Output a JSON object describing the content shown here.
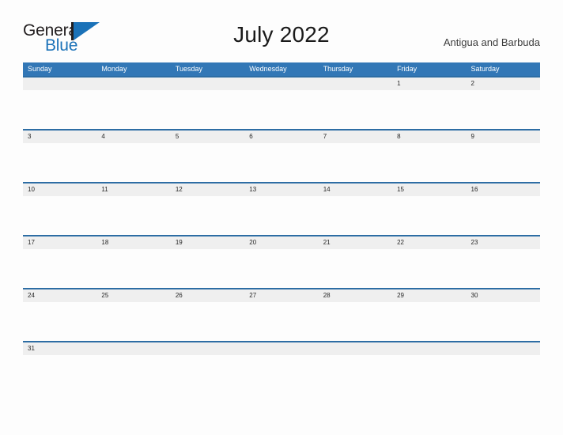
{
  "logo": {
    "word_one": "General",
    "word_two": "Blue",
    "icon": "flag-triangle-icon",
    "color_dark": "#231f20",
    "color_blue": "#1b72b8"
  },
  "header": {
    "title": "July 2022",
    "locale": "Antigua and Barbuda"
  },
  "colors": {
    "header_blue": "#3277b6",
    "row_divider_blue": "#2d6da4",
    "date_strip_gray": "#efefef",
    "page_background": "#fdfdfd"
  },
  "calendar": {
    "weekdays": [
      "Sunday",
      "Monday",
      "Tuesday",
      "Wednesday",
      "Thursday",
      "Friday",
      "Saturday"
    ],
    "weeks": [
      [
        "",
        "",
        "",
        "",
        "",
        "1",
        "2"
      ],
      [
        "3",
        "4",
        "5",
        "6",
        "7",
        "8",
        "9"
      ],
      [
        "10",
        "11",
        "12",
        "13",
        "14",
        "15",
        "16"
      ],
      [
        "17",
        "18",
        "19",
        "20",
        "21",
        "22",
        "23"
      ],
      [
        "24",
        "25",
        "26",
        "27",
        "28",
        "29",
        "30"
      ],
      [
        "31",
        "",
        "",
        "",
        "",
        "",
        ""
      ]
    ]
  }
}
